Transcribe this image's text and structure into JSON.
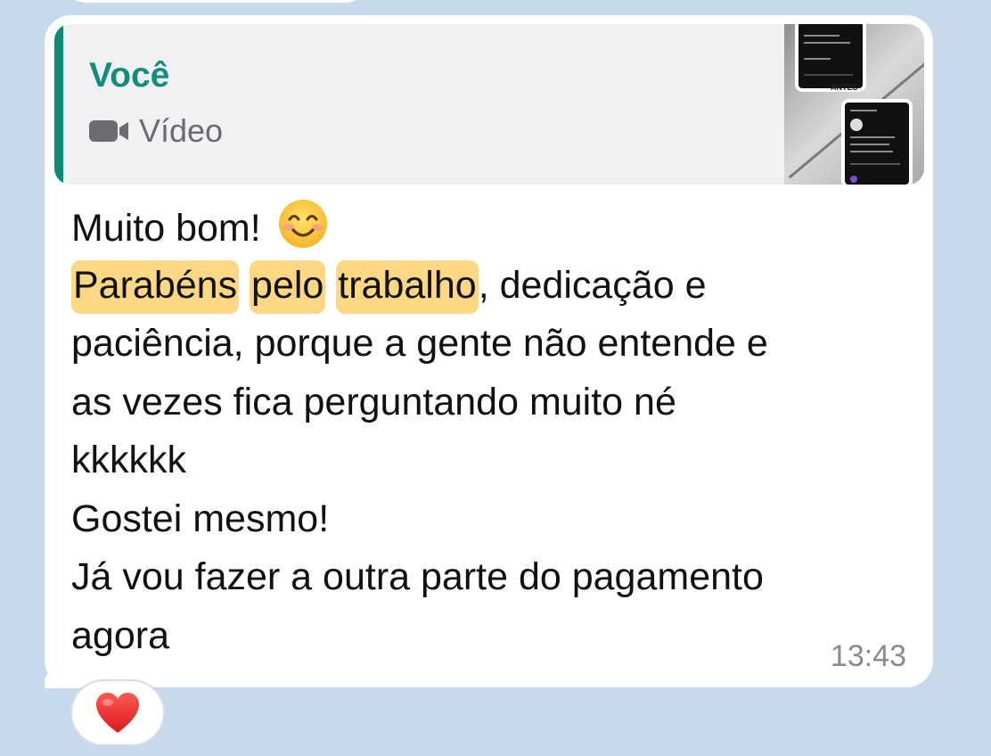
{
  "quote": {
    "author": "Você",
    "type_label": "Vídeo",
    "thumbnail_caption": "ANTES"
  },
  "message": {
    "lines": [
      "Muito bom!",
      "Parabéns",
      "pelo",
      "trabalho",
      ", dedicação e",
      "paciência, porque a gente não entende e",
      "as vezes fica perguntando muito né",
      "kkkkkk",
      "Gostei mesmo!",
      "Já vou fazer a outra parte do pagamento",
      "agora"
    ],
    "emoji": "smiling-face-with-smiling-eyes",
    "time": "13:43",
    "highlight_color": "#fcd885"
  },
  "reaction": {
    "emoji": "red-heart"
  },
  "colors": {
    "background": "#c9d9ec",
    "quote_accent": "#128c7e",
    "bubble": "#ffffff"
  }
}
